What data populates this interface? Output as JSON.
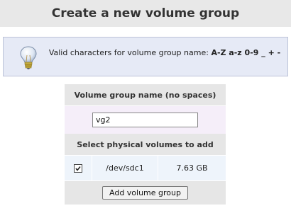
{
  "page": {
    "title": "Create a new volume group"
  },
  "info": {
    "icon": "lightbulb-icon",
    "prefix": "Valid characters for volume group name: ",
    "chars": "A-Z a-z 0-9 _ + -"
  },
  "form": {
    "name_header": "Volume group name (no spaces)",
    "name_value": "vg2",
    "pv_header": "Select physical volumes to add",
    "physical_volumes": [
      {
        "checked": true,
        "device": "/dev/sdc1",
        "size": "7.63 GB"
      }
    ],
    "submit_label": "Add volume group"
  }
}
